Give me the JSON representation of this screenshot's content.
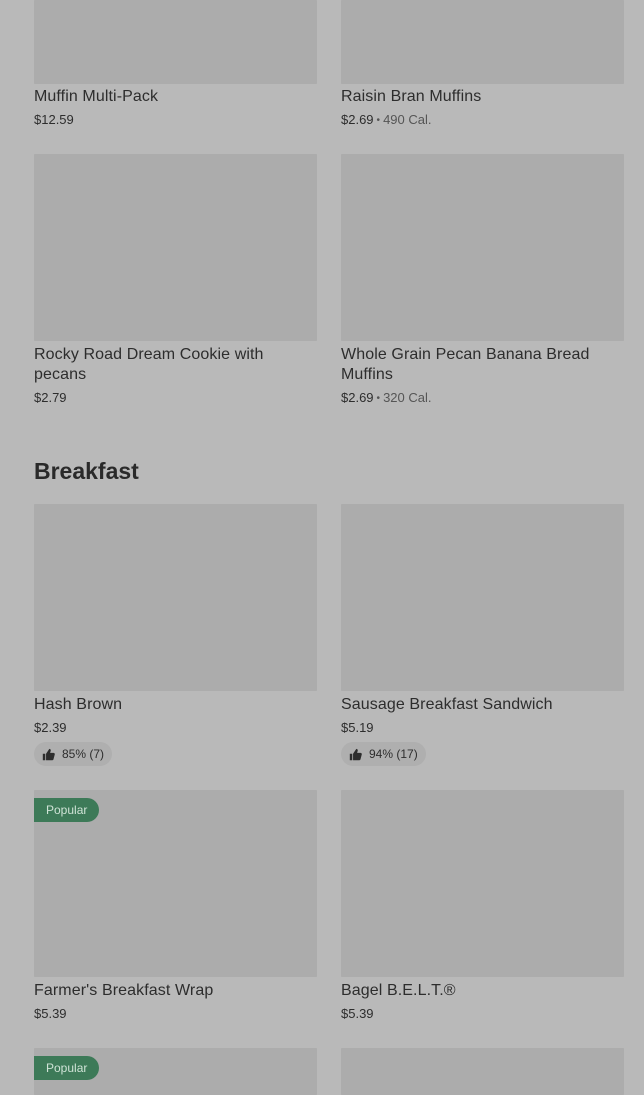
{
  "top_items": [
    {
      "name": "Muffin Multi-Pack",
      "price": "$12.59",
      "calories": ""
    },
    {
      "name": "Raisin Bran Muffins",
      "price": "$2.69",
      "calories": "490 Cal."
    },
    {
      "name": "Rocky Road Dream Cookie with pecans",
      "price": "$2.79",
      "calories": ""
    },
    {
      "name": "Whole Grain Pecan Banana Bread Muffins",
      "price": "$2.69",
      "calories": "320 Cal."
    }
  ],
  "separator": "•",
  "breakfast": {
    "title": "Breakfast",
    "items": [
      {
        "name": "Hash Brown",
        "price": "$2.39",
        "rating": "85% (7)"
      },
      {
        "name": "Sausage Breakfast Sandwich",
        "price": "$5.19",
        "rating": "94% (17)"
      },
      {
        "name": "Farmer's Breakfast Wrap",
        "price": "$5.39",
        "badge": "Popular"
      },
      {
        "name": "Bagel B.E.L.T.®",
        "price": "$5.39"
      },
      {
        "badge": "Popular"
      }
    ]
  },
  "colors": {
    "overlay_bg": "#b9b9b9",
    "image_placeholder": "#acacac",
    "popular_badge": "#3d7a58",
    "text": "#2d2d2d"
  }
}
